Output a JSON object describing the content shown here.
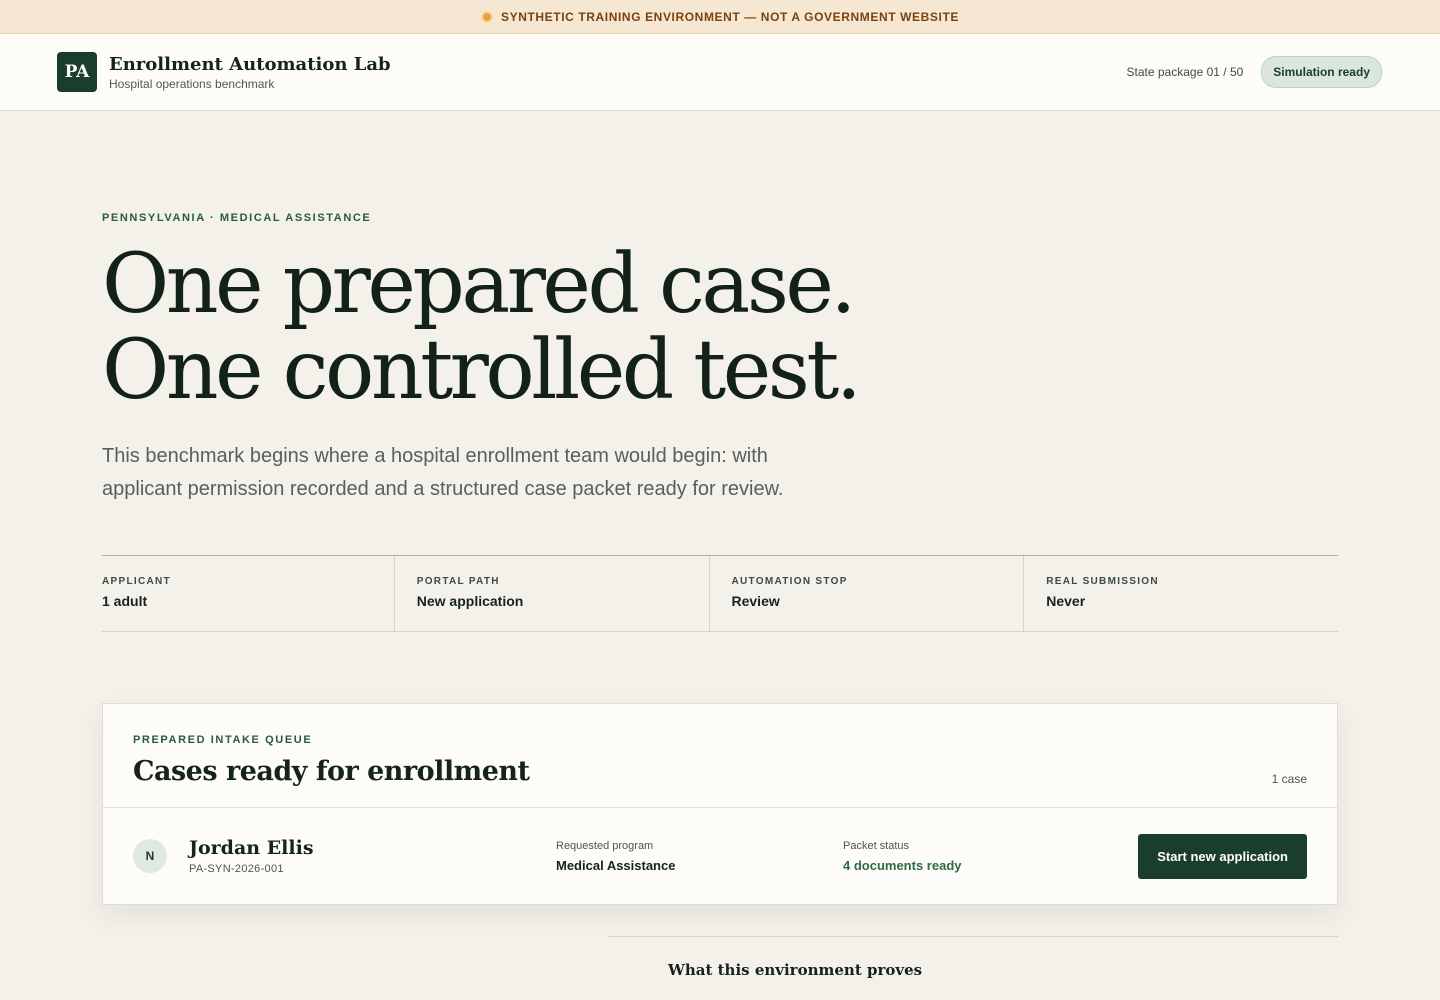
{
  "banner": {
    "text": "SYNTHETIC TRAINING ENVIRONMENT — NOT A GOVERNMENT WEBSITE"
  },
  "header": {
    "logo": "PA",
    "title": "Enrollment Automation Lab",
    "subtitle": "Hospital operations benchmark",
    "state_package": "State package 01 / 50",
    "status_badge": "Simulation ready"
  },
  "hero": {
    "eyebrow": "PENNSYLVANIA · MEDICAL ASSISTANCE",
    "headline_line1": "One prepared case.",
    "headline_line2": "One controlled test.",
    "lede": "This benchmark begins where a hospital enrollment team would begin: with applicant permission recorded and a structured case packet ready for review."
  },
  "stats": [
    {
      "label": "APPLICANT",
      "value": "1 adult"
    },
    {
      "label": "PORTAL PATH",
      "value": "New application"
    },
    {
      "label": "AUTOMATION STOP",
      "value": "Review"
    },
    {
      "label": "REAL SUBMISSION",
      "value": "Never"
    }
  ],
  "queue": {
    "eyebrow": "PREPARED INTAKE QUEUE",
    "title": "Cases ready for enrollment",
    "count": "1 case",
    "cases": [
      {
        "initial": "N",
        "name": "Jordan Ellis",
        "id": "PA-SYN-2026-001",
        "program_label": "Requested program",
        "program_value": "Medical Assistance",
        "status_label": "Packet status",
        "status_value": "4 documents ready",
        "action_label": "Start new application"
      }
    ]
  },
  "proves": {
    "title": "What this environment proves"
  },
  "colors": {
    "brand": "#1b3d2d",
    "banner_bg": "#f5e7d1",
    "page_bg": "#f3f1ea",
    "status_green": "#2f6b44"
  }
}
